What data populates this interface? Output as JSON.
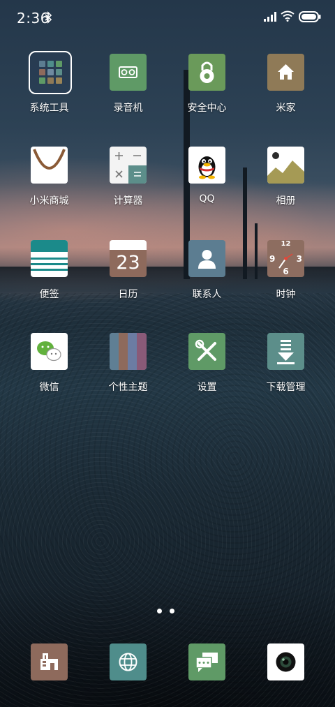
{
  "status_bar": {
    "time": "2:36",
    "bluetooth_icon": "bluetooth-icon",
    "signal_icon": "signal-icon",
    "wifi_icon": "wifi-icon",
    "battery_icon": "battery-icon"
  },
  "home": {
    "apps": [
      {
        "label": "系统工具",
        "icon": "folder-icon"
      },
      {
        "label": "录音机",
        "icon": "recorder-icon",
        "color": "#5f9a66"
      },
      {
        "label": "安全中心",
        "icon": "security-icon",
        "color": "#6a9a5a"
      },
      {
        "label": "米家",
        "icon": "home-icon",
        "color": "#8f7a57"
      },
      {
        "label": "小米商城",
        "icon": "shopping-bag-icon",
        "color": "#ffffff"
      },
      {
        "label": "计算器",
        "icon": "calculator-icon",
        "color": "#f5f5f5"
      },
      {
        "label": "QQ",
        "icon": "qq-penguin-icon",
        "color": "#ffffff"
      },
      {
        "label": "相册",
        "icon": "gallery-icon",
        "color": "#ffffff"
      },
      {
        "label": "便签",
        "icon": "notes-icon",
        "color": "#ffffff"
      },
      {
        "label": "日历",
        "icon": "calendar-icon",
        "color": "#8e6a5c"
      },
      {
        "label": "联系人",
        "icon": "contacts-icon",
        "color": "#5c7d91"
      },
      {
        "label": "时钟",
        "icon": "clock-icon",
        "color": "#8d6d60"
      },
      {
        "label": "微信",
        "icon": "wechat-icon",
        "color": "#ffffff"
      },
      {
        "label": "个性主题",
        "icon": "themes-icon",
        "color": "#6f8aa0"
      },
      {
        "label": "设置",
        "icon": "settings-icon",
        "color": "#5f9a66"
      },
      {
        "label": "下载管理",
        "icon": "download-icon",
        "color": "#5c8e8a"
      }
    ],
    "calendar_day": "23",
    "clock_face_numbers": [
      "12",
      "3",
      "6",
      "9"
    ],
    "page_indicator": {
      "pages": 2,
      "current": 1
    }
  },
  "dock": [
    {
      "icon": "phone-icon",
      "color": "#8e6a5c"
    },
    {
      "icon": "browser-icon",
      "color": "#4f8d8b"
    },
    {
      "icon": "messages-icon",
      "color": "#5f9a66"
    },
    {
      "icon": "camera-icon",
      "color": "#ffffff"
    }
  ]
}
